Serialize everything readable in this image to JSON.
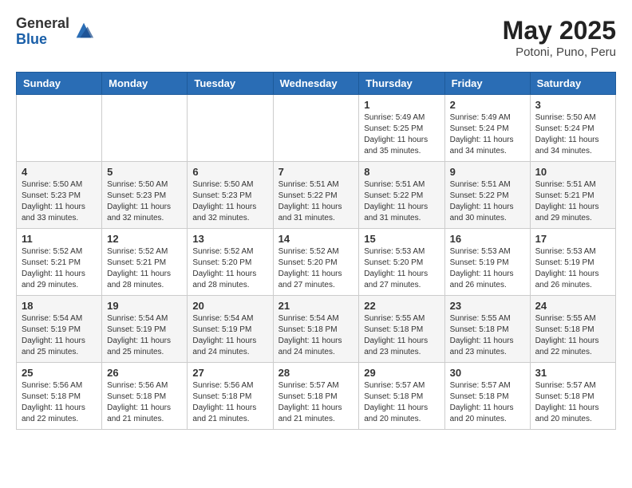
{
  "header": {
    "logo": {
      "general": "General",
      "blue": "Blue"
    },
    "title": "May 2025",
    "location": "Potoni, Puno, Peru"
  },
  "weekdays": [
    "Sunday",
    "Monday",
    "Tuesday",
    "Wednesday",
    "Thursday",
    "Friday",
    "Saturday"
  ],
  "weeks": [
    [
      {
        "day": "",
        "info": ""
      },
      {
        "day": "",
        "info": ""
      },
      {
        "day": "",
        "info": ""
      },
      {
        "day": "",
        "info": ""
      },
      {
        "day": "1",
        "info": "Sunrise: 5:49 AM\nSunset: 5:25 PM\nDaylight: 11 hours and 35 minutes."
      },
      {
        "day": "2",
        "info": "Sunrise: 5:49 AM\nSunset: 5:24 PM\nDaylight: 11 hours and 34 minutes."
      },
      {
        "day": "3",
        "info": "Sunrise: 5:50 AM\nSunset: 5:24 PM\nDaylight: 11 hours and 34 minutes."
      }
    ],
    [
      {
        "day": "4",
        "info": "Sunrise: 5:50 AM\nSunset: 5:23 PM\nDaylight: 11 hours and 33 minutes."
      },
      {
        "day": "5",
        "info": "Sunrise: 5:50 AM\nSunset: 5:23 PM\nDaylight: 11 hours and 32 minutes."
      },
      {
        "day": "6",
        "info": "Sunrise: 5:50 AM\nSunset: 5:23 PM\nDaylight: 11 hours and 32 minutes."
      },
      {
        "day": "7",
        "info": "Sunrise: 5:51 AM\nSunset: 5:22 PM\nDaylight: 11 hours and 31 minutes."
      },
      {
        "day": "8",
        "info": "Sunrise: 5:51 AM\nSunset: 5:22 PM\nDaylight: 11 hours and 31 minutes."
      },
      {
        "day": "9",
        "info": "Sunrise: 5:51 AM\nSunset: 5:22 PM\nDaylight: 11 hours and 30 minutes."
      },
      {
        "day": "10",
        "info": "Sunrise: 5:51 AM\nSunset: 5:21 PM\nDaylight: 11 hours and 29 minutes."
      }
    ],
    [
      {
        "day": "11",
        "info": "Sunrise: 5:52 AM\nSunset: 5:21 PM\nDaylight: 11 hours and 29 minutes."
      },
      {
        "day": "12",
        "info": "Sunrise: 5:52 AM\nSunset: 5:21 PM\nDaylight: 11 hours and 28 minutes."
      },
      {
        "day": "13",
        "info": "Sunrise: 5:52 AM\nSunset: 5:20 PM\nDaylight: 11 hours and 28 minutes."
      },
      {
        "day": "14",
        "info": "Sunrise: 5:52 AM\nSunset: 5:20 PM\nDaylight: 11 hours and 27 minutes."
      },
      {
        "day": "15",
        "info": "Sunrise: 5:53 AM\nSunset: 5:20 PM\nDaylight: 11 hours and 27 minutes."
      },
      {
        "day": "16",
        "info": "Sunrise: 5:53 AM\nSunset: 5:19 PM\nDaylight: 11 hours and 26 minutes."
      },
      {
        "day": "17",
        "info": "Sunrise: 5:53 AM\nSunset: 5:19 PM\nDaylight: 11 hours and 26 minutes."
      }
    ],
    [
      {
        "day": "18",
        "info": "Sunrise: 5:54 AM\nSunset: 5:19 PM\nDaylight: 11 hours and 25 minutes."
      },
      {
        "day": "19",
        "info": "Sunrise: 5:54 AM\nSunset: 5:19 PM\nDaylight: 11 hours and 25 minutes."
      },
      {
        "day": "20",
        "info": "Sunrise: 5:54 AM\nSunset: 5:19 PM\nDaylight: 11 hours and 24 minutes."
      },
      {
        "day": "21",
        "info": "Sunrise: 5:54 AM\nSunset: 5:18 PM\nDaylight: 11 hours and 24 minutes."
      },
      {
        "day": "22",
        "info": "Sunrise: 5:55 AM\nSunset: 5:18 PM\nDaylight: 11 hours and 23 minutes."
      },
      {
        "day": "23",
        "info": "Sunrise: 5:55 AM\nSunset: 5:18 PM\nDaylight: 11 hours and 23 minutes."
      },
      {
        "day": "24",
        "info": "Sunrise: 5:55 AM\nSunset: 5:18 PM\nDaylight: 11 hours and 22 minutes."
      }
    ],
    [
      {
        "day": "25",
        "info": "Sunrise: 5:56 AM\nSunset: 5:18 PM\nDaylight: 11 hours and 22 minutes."
      },
      {
        "day": "26",
        "info": "Sunrise: 5:56 AM\nSunset: 5:18 PM\nDaylight: 11 hours and 21 minutes."
      },
      {
        "day": "27",
        "info": "Sunrise: 5:56 AM\nSunset: 5:18 PM\nDaylight: 11 hours and 21 minutes."
      },
      {
        "day": "28",
        "info": "Sunrise: 5:57 AM\nSunset: 5:18 PM\nDaylight: 11 hours and 21 minutes."
      },
      {
        "day": "29",
        "info": "Sunrise: 5:57 AM\nSunset: 5:18 PM\nDaylight: 11 hours and 20 minutes."
      },
      {
        "day": "30",
        "info": "Sunrise: 5:57 AM\nSunset: 5:18 PM\nDaylight: 11 hours and 20 minutes."
      },
      {
        "day": "31",
        "info": "Sunrise: 5:57 AM\nSunset: 5:18 PM\nDaylight: 11 hours and 20 minutes."
      }
    ]
  ]
}
